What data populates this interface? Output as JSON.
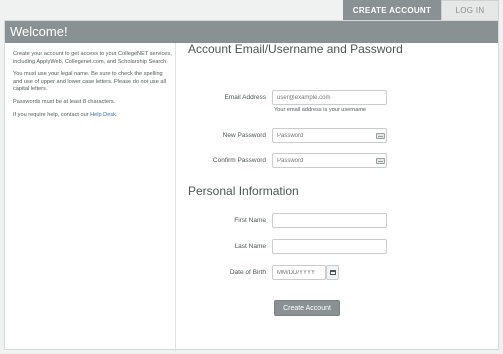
{
  "tabs": {
    "create_account": "CREATE ACCOUNT",
    "log_in": "LOG IN"
  },
  "banner": {
    "title": "Welcome!"
  },
  "sidebar": {
    "para1": "Create your account to get access to your CollegeNET services, including ApplyWeb, Collegenet.com, and Scholarship Search.",
    "para2": "You must use your legal name. Be sure to check the spelling and use of upper and lower case letters. Please do not use all capital letters.",
    "para3": "Passwords must be at least 8 characters.",
    "para4_prefix": "If you require help, contact our ",
    "help_link": "Help Desk",
    "para4_suffix": "."
  },
  "account_section": {
    "title": "Account Email/Username and Password",
    "email_label": "Email Address",
    "email_placeholder": "user@example.com",
    "email_hint": "Your email address is your username",
    "new_password_label": "New Password",
    "new_password_placeholder": "Password",
    "confirm_password_label": "Confirm Password",
    "confirm_password_placeholder": "Password"
  },
  "personal_section": {
    "title": "Personal Information",
    "first_name_label": "First Name",
    "first_name_value": "",
    "last_name_label": "Last Name",
    "last_name_value": "",
    "dob_label": "Date of Birth",
    "dob_placeholder": "MM/DD/YYYY"
  },
  "actions": {
    "create_account_button": "Create Account"
  },
  "icons": {
    "keyboard": "keyboard-icon",
    "calendar": "calendar-icon"
  },
  "colors": {
    "banner": "#8a9192",
    "link": "#3b6fb6"
  }
}
